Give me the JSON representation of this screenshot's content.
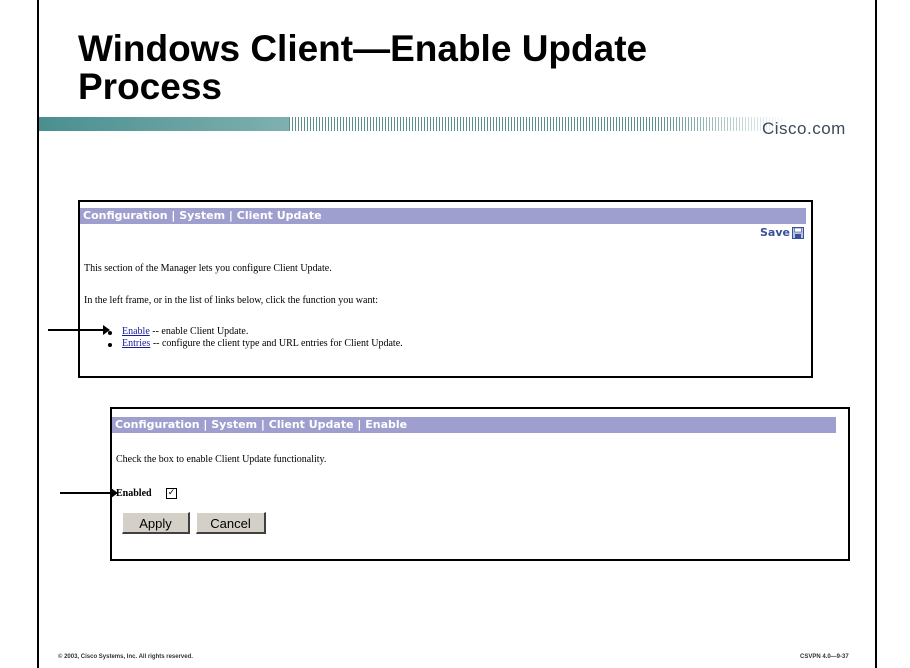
{
  "slide": {
    "title": "Windows Client—Enable Update Process",
    "logo_text": "Cisco.com",
    "footer_left": "© 2003, Cisco Systems, Inc. All rights reserved.",
    "footer_right": "CSVPN 4.0—9-37"
  },
  "panel1": {
    "header": "Configuration | System | Client Update",
    "save_label": "Save",
    "save_icon": "floppy-disk-icon",
    "intro": "This section of the Manager lets you configure Client Update.",
    "instruction": "In the left frame, or in the list of links below, click the function you want:",
    "items": [
      {
        "link": "Enable",
        "desc": " -- enable Client Update."
      },
      {
        "link": "Entries",
        "desc": " -- configure the client type and URL entries for Client Update."
      }
    ]
  },
  "panel2": {
    "header": "Configuration | System | Client Update | Enable",
    "instruction": "Check the box to enable Client Update functionality.",
    "enabled_label": "Enabled",
    "enabled_checked": true,
    "check_glyph": "✓",
    "apply_label": "Apply",
    "cancel_label": "Cancel"
  },
  "colors": {
    "header_bg": "#9f9fcf",
    "banner_teal": "#4a8f8f",
    "link": "#1a1a9a"
  }
}
